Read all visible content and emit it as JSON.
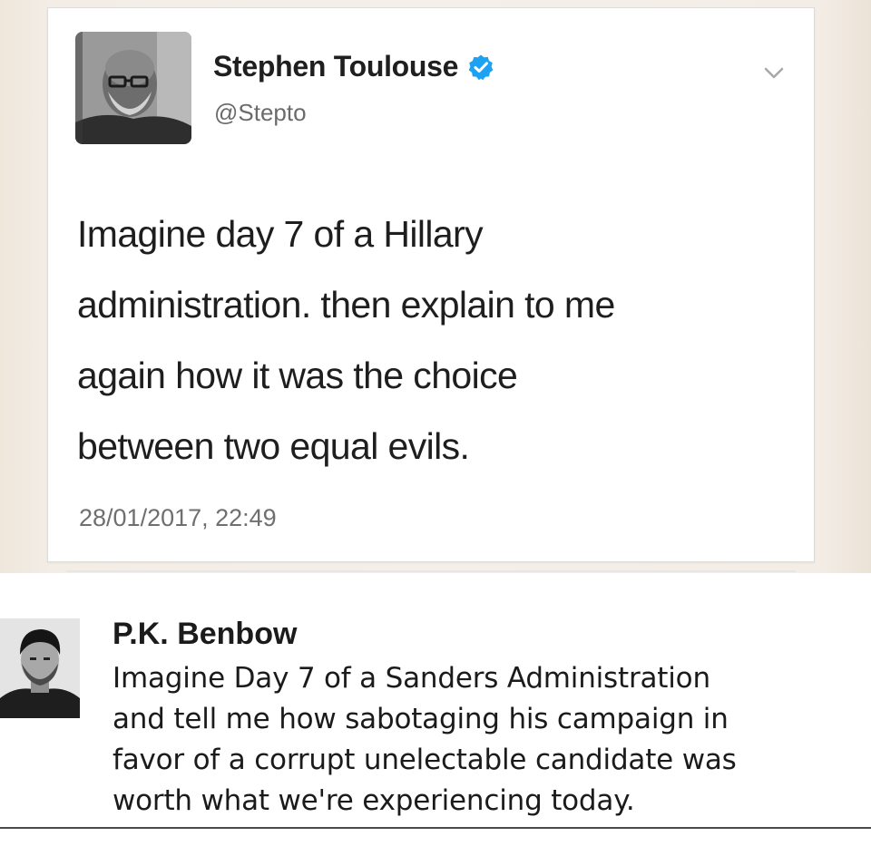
{
  "tweet": {
    "author_name": "Stephen Toulouse",
    "handle": "@Stepto",
    "verified": true,
    "text_lines": [
      "Imagine day 7 of a Hillary",
      "administration. then explain to me",
      "again how it was the choice",
      "between two equal evils."
    ],
    "timestamp": "28/01/2017, 22:49",
    "verified_color": "#1da1f2",
    "menu_icon": "chevron-down-icon"
  },
  "reply": {
    "author_name": "P.K. Benbow",
    "text_lines": [
      "Imagine Day 7 of a Sanders Administration",
      "and tell me how sabotaging his campaign in",
      "favor of a corrupt unelectable candidate was",
      "worth what we're experiencing today."
    ]
  }
}
